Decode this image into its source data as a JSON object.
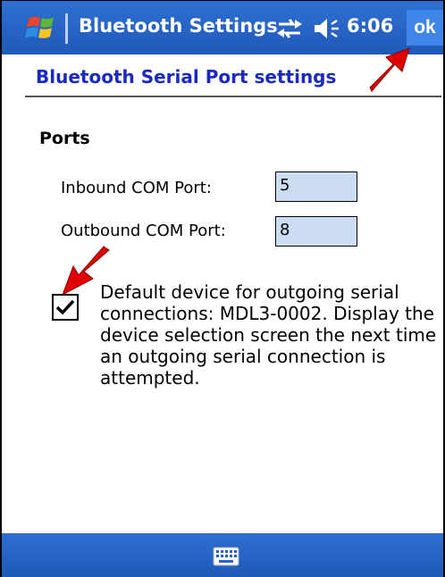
{
  "title_bar": {
    "app_title": "Bluetooth Settings",
    "time": "6:06",
    "ok_label": "ok",
    "icons": [
      "windows-start-logo",
      "connectivity-icon",
      "volume-icon"
    ]
  },
  "page": {
    "heading": "Bluetooth Serial Port settings"
  },
  "ports": {
    "section_title": "Ports",
    "inbound": {
      "label": "Inbound COM Port:",
      "value": "5"
    },
    "outbound": {
      "label": "Outbound COM Port:",
      "value": "8"
    }
  },
  "default_device": {
    "checked": true,
    "text": "Default device for outgoing serial connections: MDL3-0002. Display the device selection screen the next time an outgoing serial connection is attempted."
  },
  "bottom_bar": {
    "icons": [
      "keyboard-icon"
    ]
  },
  "colors": {
    "bar_blue": "#2463c8",
    "heading_blue": "#1a28c4",
    "input_fill": "#ccdcf2",
    "annotation_red": "#e00000"
  }
}
